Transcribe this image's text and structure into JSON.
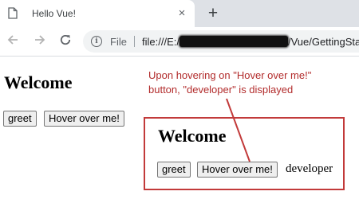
{
  "browser": {
    "tab_title": "Hello Vue!",
    "tab_close_glyph": "×",
    "new_tab_glyph": "+",
    "icons": {
      "favicon": "document-icon",
      "back": "arrow-left-icon",
      "forward": "arrow-right-icon",
      "reload": "reload-icon",
      "info": "info-icon"
    },
    "omnibox": {
      "scheme_label": "File",
      "url_prefix": "file:///E:/",
      "url_suffix": "/Vue/GettingSta"
    }
  },
  "page": {
    "title": "Welcome",
    "greet_label": "greet",
    "hover_label": "Hover over me!"
  },
  "annotation": {
    "line1": "Upon hovering on \"Hover over me!\"",
    "line2": "button, \"developer\" is displayed",
    "color": "#b22b2b",
    "box_color": "#c23a3a",
    "inset": {
      "title": "Welcome",
      "greet_label": "greet",
      "hover_label": "Hover over me!",
      "result_text": "developer"
    }
  }
}
